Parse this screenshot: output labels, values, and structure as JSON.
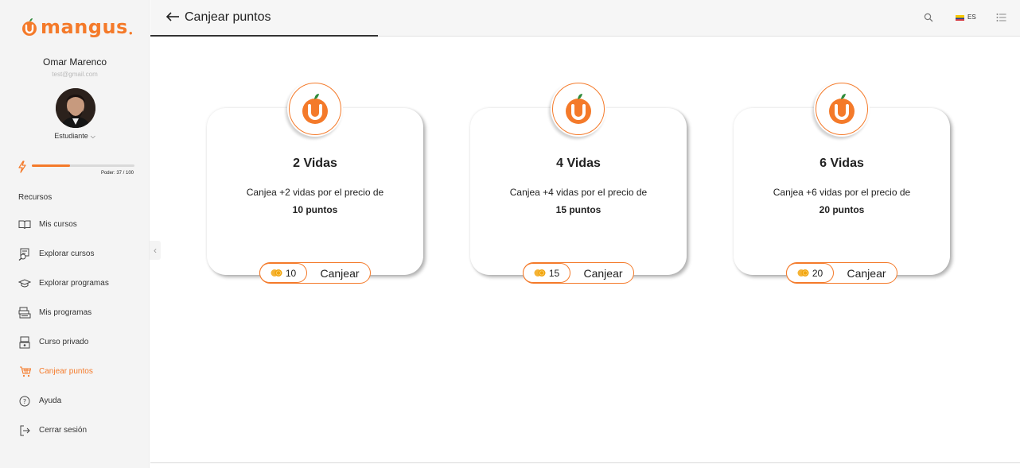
{
  "brand": {
    "name": "mangus",
    "accent": "#f47a2a"
  },
  "user": {
    "name": "Omar Marenco",
    "email": "test@gmail.com",
    "role": "Estudiante"
  },
  "power": {
    "label": "Poder: 37 / 100",
    "value": 37,
    "max": 100
  },
  "sidebar": {
    "section": "Recursos",
    "items": [
      {
        "label": "Mis cursos",
        "icon": "book-open-icon",
        "active": false
      },
      {
        "label": "Explorar cursos",
        "icon": "explore-courses-icon",
        "active": false
      },
      {
        "label": "Explorar programas",
        "icon": "graduation-cap-icon",
        "active": false
      },
      {
        "label": "Mis programas",
        "icon": "books-stack-icon",
        "active": false
      },
      {
        "label": "Curso privado",
        "icon": "private-course-icon",
        "active": false
      },
      {
        "label": "Canjear puntos",
        "icon": "cart-icon",
        "active": true
      },
      {
        "label": "Ayuda",
        "icon": "help-circle-icon",
        "active": false
      },
      {
        "label": "Cerrar sesión",
        "icon": "logout-icon",
        "active": false
      }
    ]
  },
  "header": {
    "title": "Canjear puntos",
    "lang": "ES"
  },
  "cards": [
    {
      "title": "2 Vidas",
      "desc": "Canjea +2 vidas por el precio de",
      "points": "10 puntos",
      "cost": "10",
      "action": "Canjear"
    },
    {
      "title": "4 Vidas",
      "desc": "Canjea +4 vidas por el precio de",
      "points": "15 puntos",
      "cost": "15",
      "action": "Canjear"
    },
    {
      "title": "6 Vidas",
      "desc": "Canjea +6 vidas por el precio de",
      "points": "20 puntos",
      "cost": "20",
      "action": "Canjear"
    }
  ]
}
